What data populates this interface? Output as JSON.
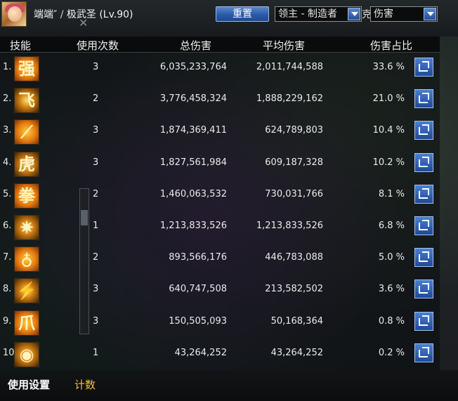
{
  "header": {
    "char_name": "端端″",
    "separator": "/",
    "char_class": "极武圣",
    "level": "(Lv.90)",
    "reset_label": "重置",
    "boss_select": "领主 - 制造者",
    "boss_select_tail": "克",
    "metric_select": "伤害"
  },
  "columns": {
    "skill": "技能",
    "uses": "使用次数",
    "total": "总伤害",
    "avg": "平均伤害",
    "pct": "伤害占比"
  },
  "rows": [
    {
      "rank": "1.",
      "glyph": "强",
      "uses": "3",
      "total": "6,035,233,764",
      "avg": "2,011,744,588",
      "pct": "33.6 %"
    },
    {
      "rank": "2.",
      "glyph": "飞",
      "uses": "2",
      "total": "3,776,458,324",
      "avg": "1,888,229,162",
      "pct": "21.0 %"
    },
    {
      "rank": "3.",
      "glyph": "⟋",
      "uses": "3",
      "total": "1,874,369,411",
      "avg": "624,789,803",
      "pct": "10.4 %"
    },
    {
      "rank": "4.",
      "glyph": "虎",
      "uses": "3",
      "total": "1,827,561,984",
      "avg": "609,187,328",
      "pct": "10.2 %"
    },
    {
      "rank": "5.",
      "glyph": "拳",
      "uses": "2",
      "total": "1,460,063,532",
      "avg": "730,031,766",
      "pct": "8.1 %"
    },
    {
      "rank": "6.",
      "glyph": "✷",
      "uses": "1",
      "total": "1,213,833,526",
      "avg": "1,213,833,526",
      "pct": "6.8 %"
    },
    {
      "rank": "7.",
      "glyph": "♁",
      "uses": "2",
      "total": "893,566,176",
      "avg": "446,783,088",
      "pct": "5.0 %"
    },
    {
      "rank": "8.",
      "glyph": "⚡",
      "uses": "3",
      "total": "640,747,508",
      "avg": "213,582,502",
      "pct": "3.6 %"
    },
    {
      "rank": "9.",
      "glyph": "爪",
      "uses": "3",
      "total": "150,505,093",
      "avg": "50,168,364",
      "pct": "0.8 %"
    },
    {
      "rank": "10.",
      "glyph": "◉",
      "uses": "1",
      "total": "43,264,252",
      "avg": "43,264,252",
      "pct": "0.2 %"
    }
  ],
  "footer": {
    "settings_label": "使用设置",
    "count_label": "计数"
  }
}
